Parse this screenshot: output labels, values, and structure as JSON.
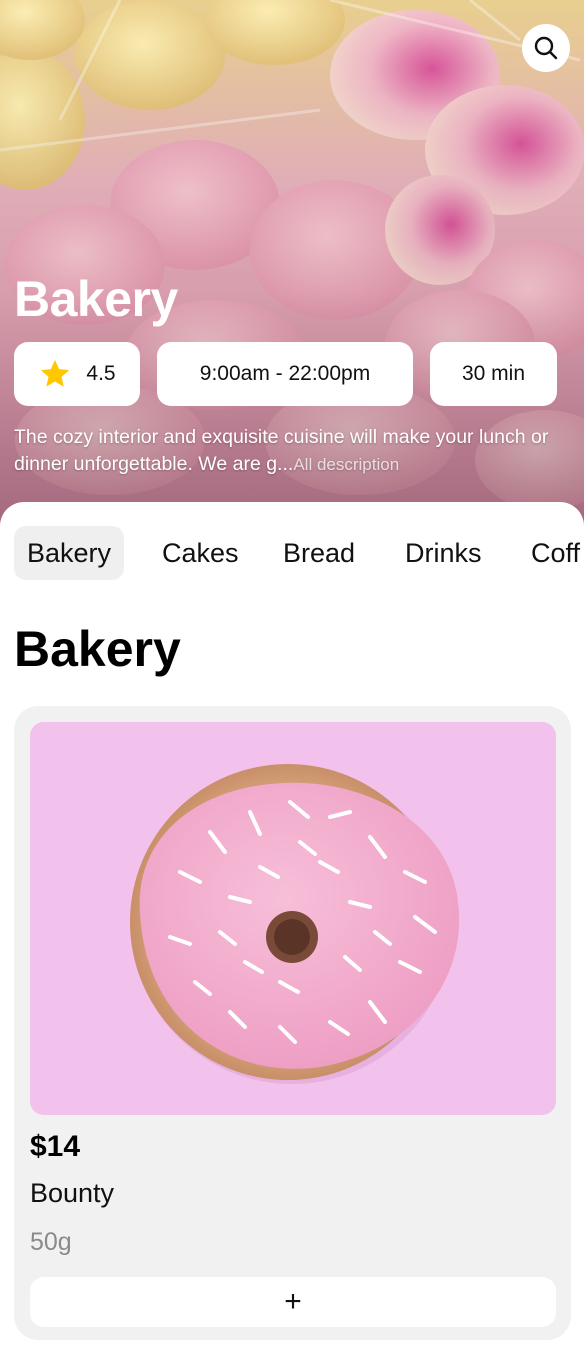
{
  "hero": {
    "title": "Bakery",
    "rating": "4.5",
    "hours": "9:00am - 22:00pm",
    "delivery_time": "30 min",
    "description": "The cozy interior and exquisite cuisine will make your lunch or dinner unforgettable. We are g...",
    "more_link": "All description"
  },
  "icons": {
    "search": "search-icon",
    "rating": "star-icon",
    "add": "plus-icon"
  },
  "tabs": [
    "Bakery",
    "Cakes",
    "Bread",
    "Drinks",
    "Coff"
  ],
  "active_tab": "Bakery",
  "section": {
    "title": "Bakery"
  },
  "product": {
    "price": "$14",
    "name": "Bounty",
    "weight": "50g",
    "add_label": "+"
  },
  "colors": {
    "star": "#FFC700",
    "card_bg": "#F1F1F1",
    "tab_active_bg": "#EFEFEF",
    "product_image_bg": "#F2C1EC"
  }
}
